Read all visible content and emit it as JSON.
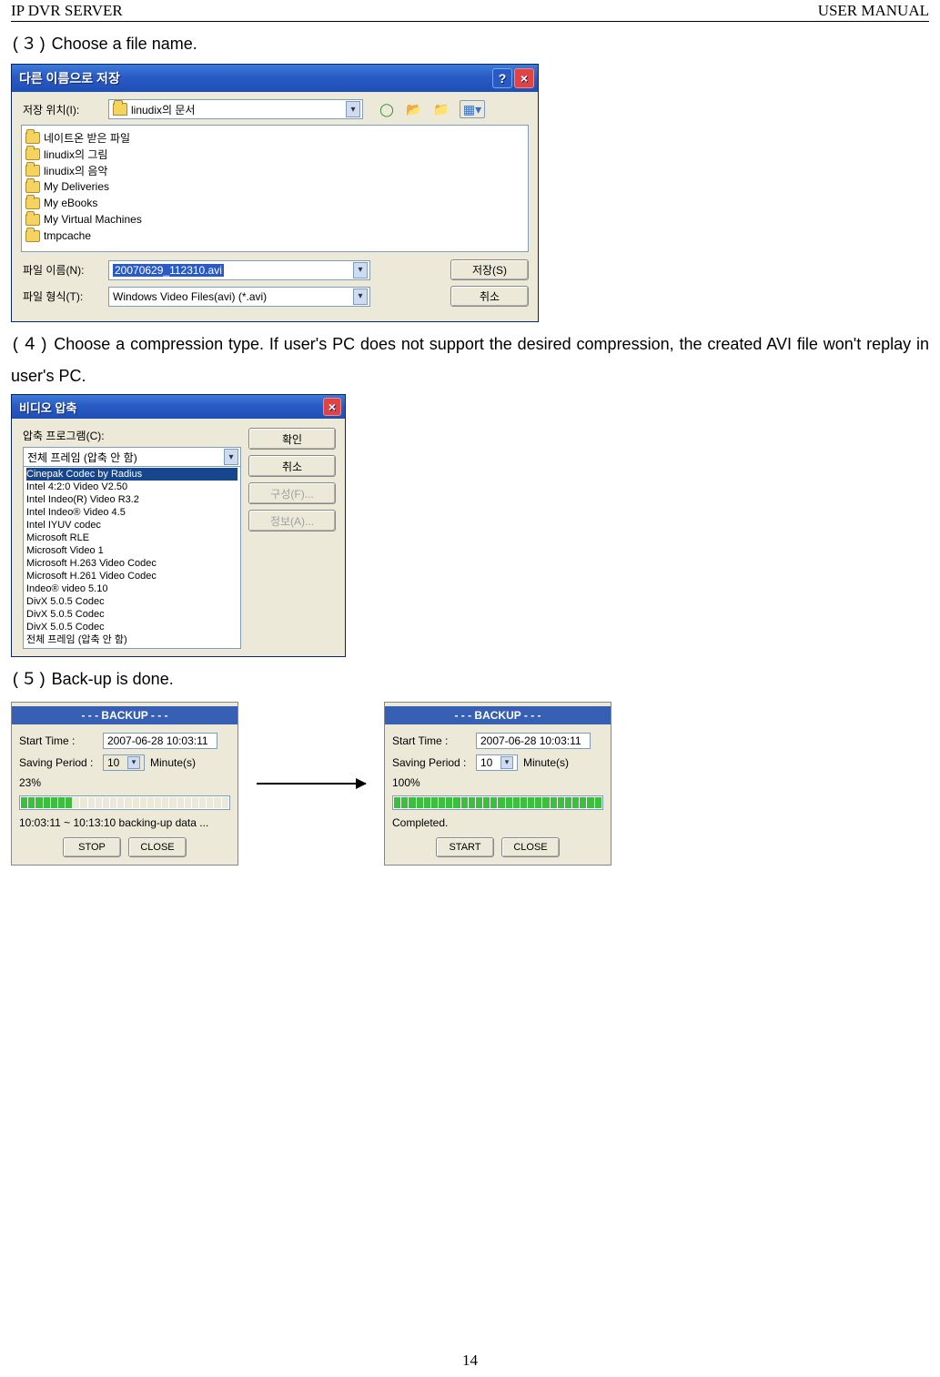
{
  "header": {
    "left": "IP DVR SERVER",
    "right": "USER MANUAL"
  },
  "page_number": "14",
  "steps": {
    "s3": {
      "num": "(３)",
      "text": "Choose a file name."
    },
    "s4": {
      "num": "(４)",
      "text": "Choose a compression type. If user's PC does not support the desired compression, the created AVI file won't replay in user's PC."
    },
    "s5": {
      "num": "(５)",
      "text": "Back-up is done."
    }
  },
  "saveas": {
    "title": "다른 이름으로 저장",
    "location_label": "저장 위치(I):",
    "location_value": "linudix의 문서",
    "entries": [
      "네이트온 받은 파일",
      "linudix의 그림",
      "linudix의 음악",
      "My Deliveries",
      "My eBooks",
      "My Virtual Machines",
      "tmpcache"
    ],
    "filename_label": "파일 이름(N):",
    "filename_value": "20070629_112310.avi",
    "filetype_label": "파일 형식(T):",
    "filetype_value": "Windows Video Files(avi) (*.avi)",
    "save_btn": "저장(S)",
    "cancel_btn": "취소"
  },
  "compress": {
    "title": "비디오 압축",
    "program_label": "압축 프로그램(C):",
    "selected": "전체 프레임 (압축 안 함)",
    "highlighted": "Cinepak Codec by Radius",
    "options": [
      "Intel 4:2:0 Video V2.50",
      "Intel Indeo(R) Video R3.2",
      "Intel Indeo® Video 4.5",
      "Intel IYUV codec",
      "Microsoft RLE",
      "Microsoft Video 1",
      "Microsoft H.263 Video Codec",
      "Microsoft H.261 Video Codec",
      "Indeo® video 5.10",
      "DivX 5.0.5 Codec",
      "DivX 5.0.5 Codec",
      "DivX 5.0.5 Codec",
      "전체 프레임 (압축 안 함)"
    ],
    "ok_btn": "확인",
    "cancel_btn": "취소",
    "config_btn": "구성(F)...",
    "info_btn": "정보(A)..."
  },
  "backup_left": {
    "title": "- - -  BACKUP  - - -",
    "start_label": "Start Time :",
    "start_value": "2007-06-28 10:03:11",
    "period_label": "Saving Period :",
    "period_value": "10",
    "period_unit": "Minute(s)",
    "percent": "23%",
    "status": "10:03:11 ~ 10:13:10 backing-up data ...",
    "stop_btn": "STOP",
    "close_btn": "CLOSE",
    "segments_on": 7,
    "segments_total": 28
  },
  "backup_right": {
    "title": "- - -  BACKUP  - - -",
    "start_label": "Start Time :",
    "start_value": "2007-06-28 10:03:11",
    "period_label": "Saving Period :",
    "period_value": "10",
    "period_unit": "Minute(s)",
    "percent": "100%",
    "status": "Completed.",
    "start_btn": "START",
    "close_btn": "CLOSE",
    "segments_on": 28,
    "segments_total": 28
  }
}
